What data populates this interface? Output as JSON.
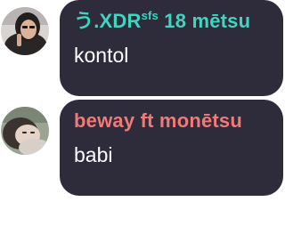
{
  "messages": [
    {
      "sender": {
        "prefix": "う.XDR",
        "superscript": "sfs",
        "suffix": " 18 mētsu",
        "color": "#3fd5c0"
      },
      "text": "kontol"
    },
    {
      "sender": {
        "prefix": "beway ft monētsu",
        "superscript": "",
        "suffix": "",
        "color": "#f07a78"
      },
      "text": "babi"
    }
  ],
  "colors": {
    "bubble_bg": "#2e2b3b",
    "message_text": "#ffffff"
  }
}
